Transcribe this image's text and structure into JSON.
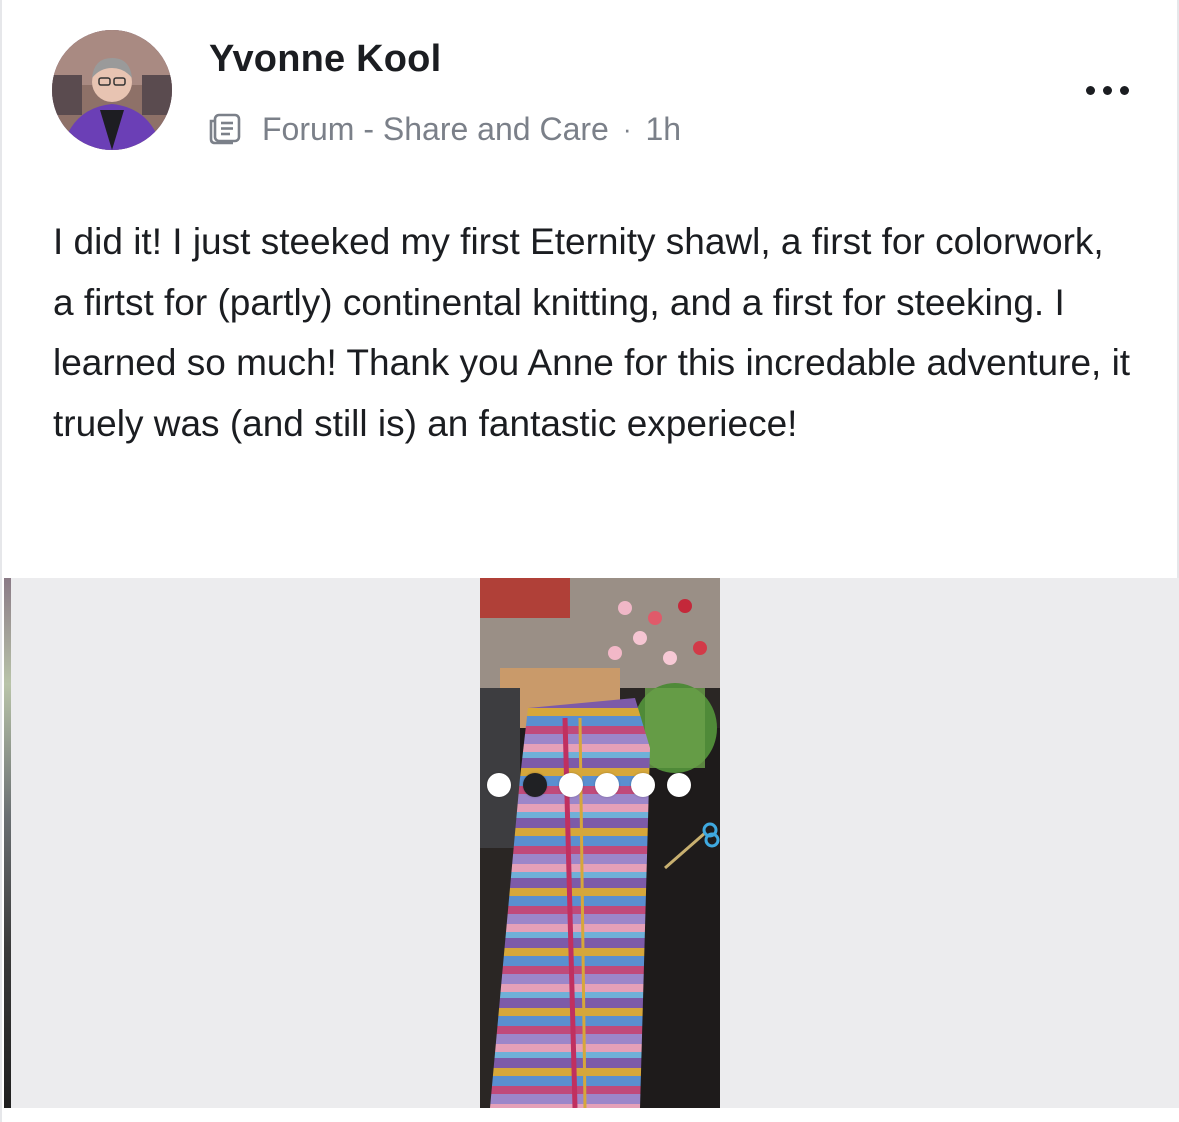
{
  "post": {
    "author": "Yvonne Kool",
    "channel": "Forum - Share and Care",
    "separator": "·",
    "time": "1h",
    "body": "I did it! I just steeked my first Eternity shawl, a first for colorwork, a firtst for (partly) continental knitting, and a first for steeking. I learned so much! Thank you Anne for this incredable adventure, it truely was (and still is) an fantastic experiece!"
  },
  "icons": {
    "forum": "forum-icon",
    "more": "more-options-icon"
  },
  "gallery": {
    "image_count": 6,
    "active_index": 1
  },
  "colors": {
    "text_primary": "#1b1d21",
    "text_secondary": "#7b8089",
    "gallery_bg": "#ececee",
    "active_dot": "#202124"
  }
}
